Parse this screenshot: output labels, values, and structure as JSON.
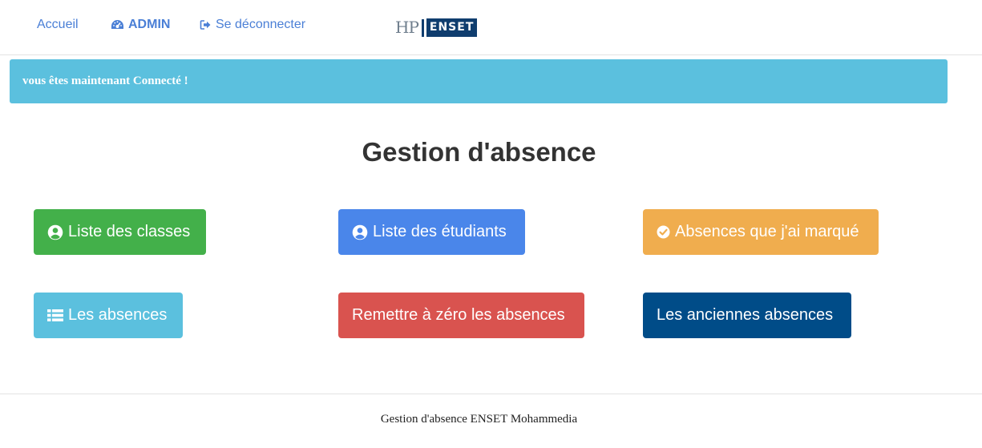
{
  "nav": {
    "home_label": "Accueil",
    "admin_label": "ADMIN",
    "admin_icon": "dashboard-icon",
    "logout_label": "Se déconnecter",
    "logout_icon": "sign-out-icon",
    "logo": {
      "left_text": "HP",
      "right_text": "ENSET"
    },
    "link_color": "#4a7fd6"
  },
  "alert": {
    "text": "vous êtes maintenant Connecté !",
    "color": "#5bc0de"
  },
  "page_title": "Gestion d'absence",
  "buttons": [
    {
      "label": "Liste des classes",
      "icon": "user-circle-icon",
      "color": "#43b04a"
    },
    {
      "label": "Liste des étudiants",
      "icon": "user-circle-icon",
      "color": "#4a86ea"
    },
    {
      "label": "Absences que j'ai marqué",
      "icon": "check-circle-icon",
      "color": "#f0ad4e"
    },
    {
      "label": "Les absences",
      "icon": "list-icon",
      "color": "#5bc0de"
    },
    {
      "label": "Remettre à zéro les absences",
      "icon": "",
      "color": "#d9534f"
    },
    {
      "label": "Les anciennes absences",
      "icon": "",
      "color": "#004c88"
    }
  ],
  "footer": {
    "text": "Gestion d'absence ENSET Mohammedia"
  }
}
